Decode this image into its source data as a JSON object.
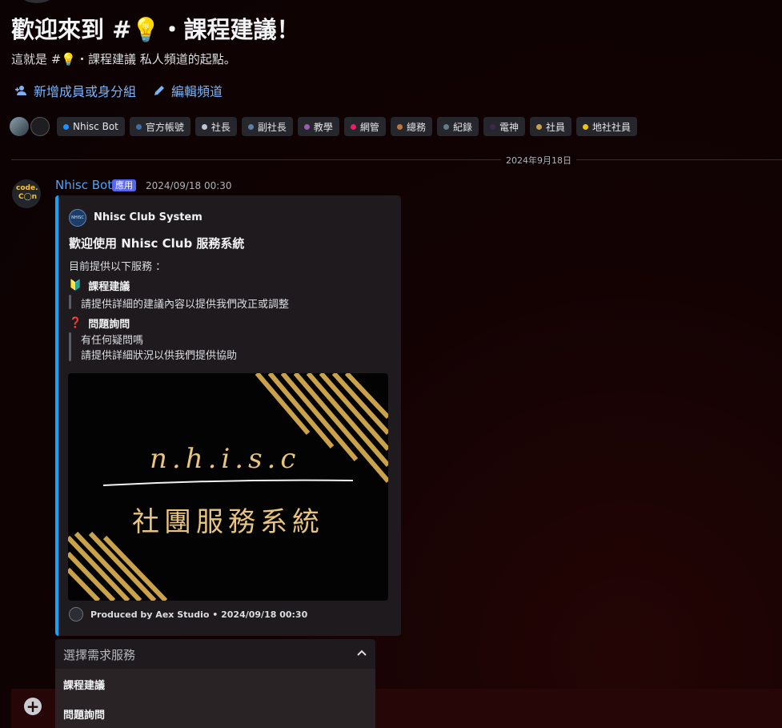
{
  "header": {
    "title_prefix": "歡迎來到 #",
    "title_icon": "💡",
    "title_suffix": "・課程建議！",
    "subtitle_prefix": "這就是 #",
    "subtitle_icon": "💡",
    "subtitle_suffix": "・課程建議 私人頻道的起點。"
  },
  "actions": {
    "add_members": "新增成員或身分組",
    "edit_channel": "編輯頻道"
  },
  "roles": [
    {
      "label": "Nhisc Bot",
      "color": "#1e90ff"
    },
    {
      "label": "官方帳號",
      "color": "#3b6fa8"
    },
    {
      "label": "社長",
      "color": "#b9c6d6"
    },
    {
      "label": "副社長",
      "color": "#5b7fa8"
    },
    {
      "label": "教學",
      "color": "#9b59b6"
    },
    {
      "label": "網管",
      "color": "#e91e63"
    },
    {
      "label": "總務",
      "color": "#c0733a"
    },
    {
      "label": "紀錄",
      "color": "#607d8b"
    },
    {
      "label": "電神",
      "color": "#3a2a4a"
    },
    {
      "label": "社員",
      "color": "#c9a04a"
    },
    {
      "label": "地社社員",
      "color": "#f1c40f"
    }
  ],
  "divider": {
    "date": "2024年9月18日"
  },
  "message": {
    "avatar_line1": "code.",
    "avatar_line2": "C◯n",
    "author": "Nhisc Bot",
    "badge": "應用",
    "timestamp": "2024/09/18 00:30"
  },
  "embed": {
    "author_icon_text": "NHISC",
    "author": "Nhisc Club System",
    "title": "歡迎使用 Nhisc Club 服務系統",
    "description": "目前提供以下服務 ：",
    "fields": [
      {
        "icon": "🔰",
        "name": "課程建議",
        "lines": [
          "請提供詳細的建議內容以提供我們改正或調整"
        ]
      },
      {
        "icon": "❓",
        "name": "問題詢問",
        "lines": [
          "有任何疑問嗎",
          "請提供詳細狀況以供我們提供協助"
        ]
      }
    ],
    "image_text_main": "n.h.i.s.c",
    "image_text_sub": "社團服務系統",
    "footer": "Produced by Aex Studio • 2024/09/18 00:30"
  },
  "select": {
    "placeholder": "選擇需求服務",
    "options": [
      "課程建議",
      "問題詢問"
    ]
  },
  "input": {
    "plus": "+"
  }
}
